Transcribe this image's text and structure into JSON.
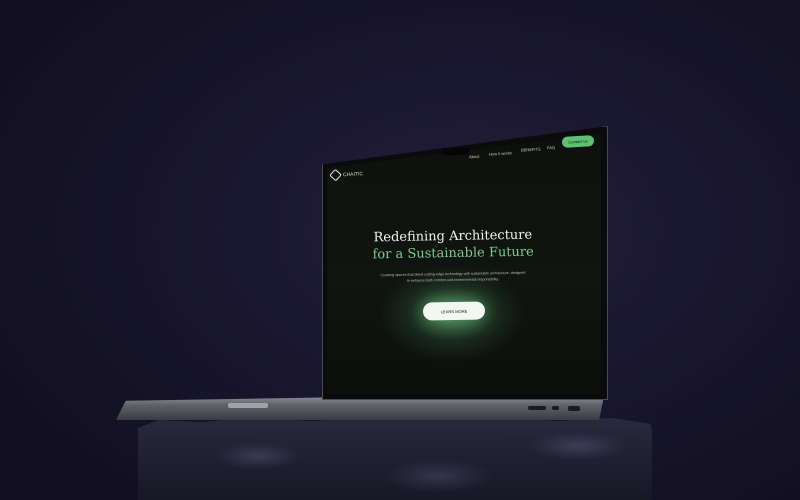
{
  "brand": {
    "logo_text": "CHAITIC",
    "logo_icon": "hexagon-logo-icon"
  },
  "nav": {
    "items": [
      {
        "label": "About"
      },
      {
        "label": "How It works"
      },
      {
        "label": "BENEFITS"
      },
      {
        "label": "FAQ"
      }
    ],
    "contact_label": "Contact us"
  },
  "hero": {
    "title_line1": "Redefining Architecture",
    "title_line2": "for a Sustainable Future",
    "subtitle": "Creating spaces that blend cutting-edge technology with sustainable architecture, designed to enhance both comfort and environmental responsibility.",
    "cta_label": "LEARN MORE"
  },
  "colors": {
    "accent": "#5fbf74",
    "accent_text": "#7ec98e",
    "background": "#14121f",
    "screen_bg": "#0e100e"
  }
}
